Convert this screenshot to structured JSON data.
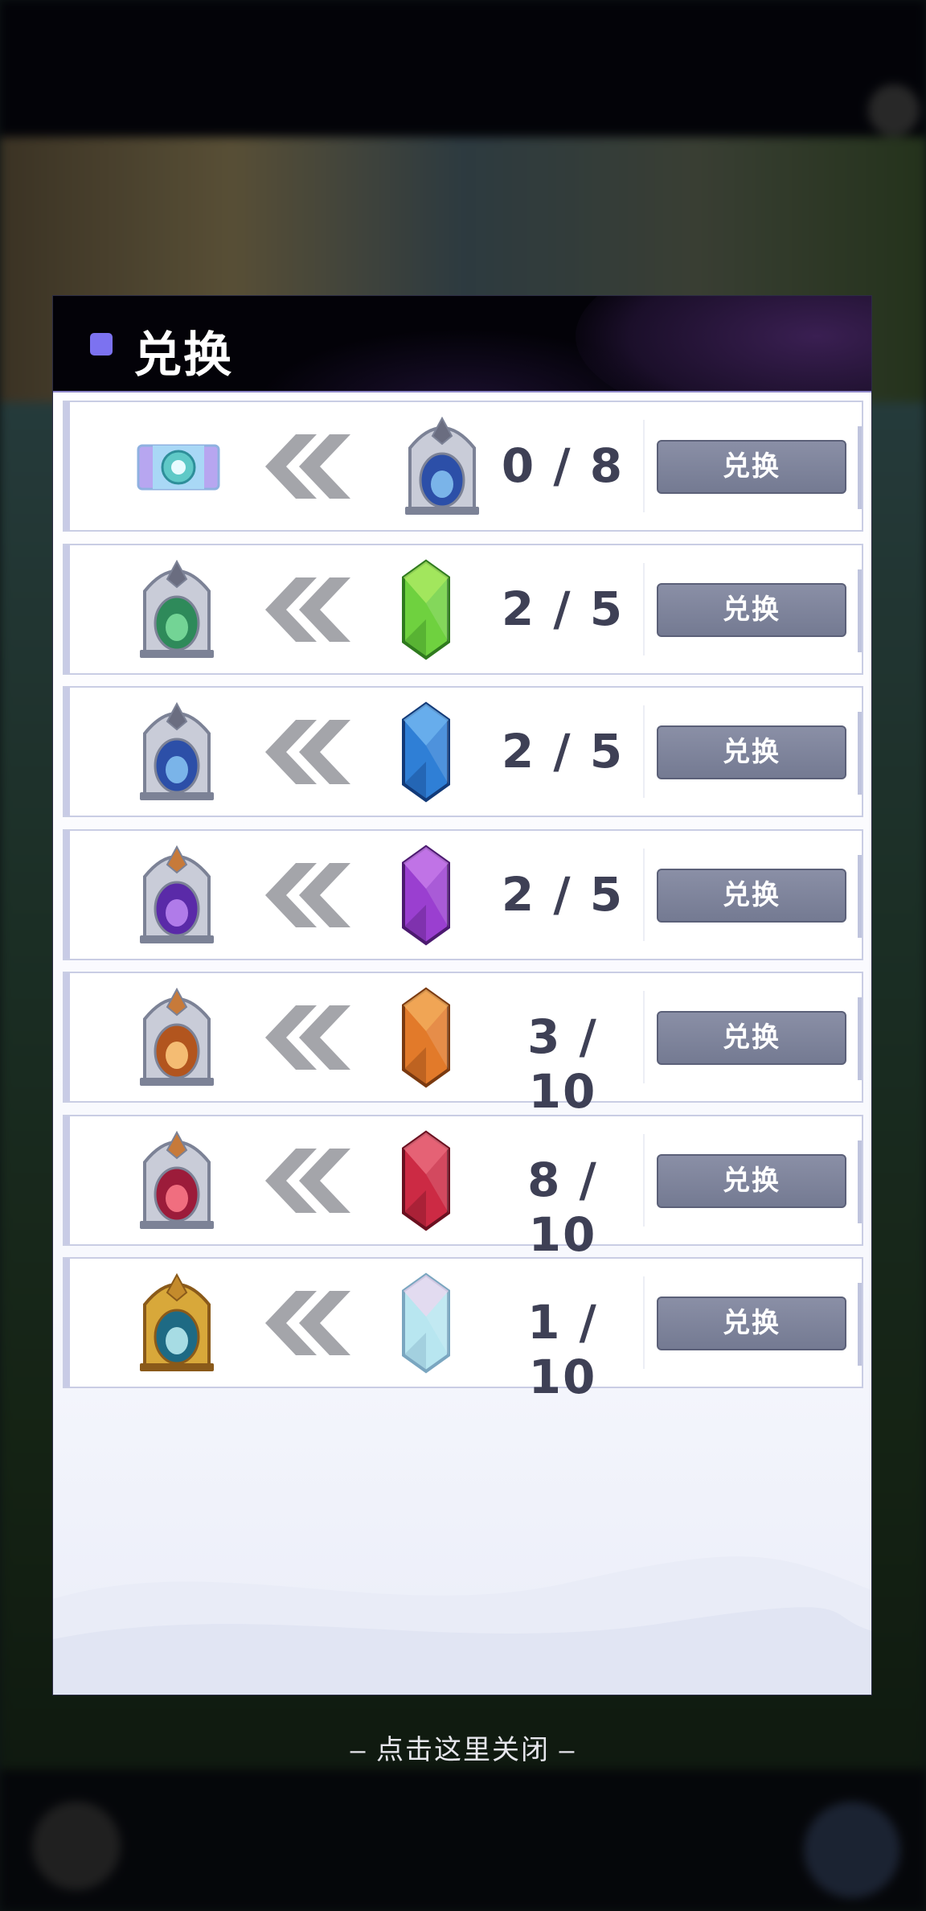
{
  "background": {
    "title": "",
    "help_label": ""
  },
  "dialog": {
    "title": "兑换",
    "accent_color": "#7c72f0",
    "button_color": "#7b8199"
  },
  "rows": [
    {
      "source_icon": "ticket-icon",
      "arrow_icon": "double-left-arrow-icon",
      "crystal_icon": "blue-portal-icon",
      "count": "0 / 8",
      "button": "兑换"
    },
    {
      "source_icon": "green-portal-icon",
      "arrow_icon": "double-left-arrow-icon",
      "crystal_icon": "green-crystal-icon",
      "count": "2 / 5",
      "button": "兑换"
    },
    {
      "source_icon": "blue-portal-icon",
      "arrow_icon": "double-left-arrow-icon",
      "crystal_icon": "blue-crystal-icon",
      "count": "2 / 5",
      "button": "兑换"
    },
    {
      "source_icon": "purple-portal-icon",
      "arrow_icon": "double-left-arrow-icon",
      "crystal_icon": "purple-crystal-icon",
      "count": "2 / 5",
      "button": "兑换"
    },
    {
      "source_icon": "orange-portal-icon",
      "arrow_icon": "double-left-arrow-icon",
      "crystal_icon": "orange-crystal-icon",
      "count": "3 / 10",
      "button": "兑换"
    },
    {
      "source_icon": "red-portal-icon",
      "arrow_icon": "double-left-arrow-icon",
      "crystal_icon": "red-crystal-icon",
      "count": "8 / 10",
      "button": "兑换"
    },
    {
      "source_icon": "gold-portal-icon",
      "arrow_icon": "double-left-arrow-icon",
      "crystal_icon": "rainbow-crystal-icon",
      "count": "1 / 10",
      "button": "兑换"
    }
  ],
  "close_hint": "– 点击这里关闭 –"
}
